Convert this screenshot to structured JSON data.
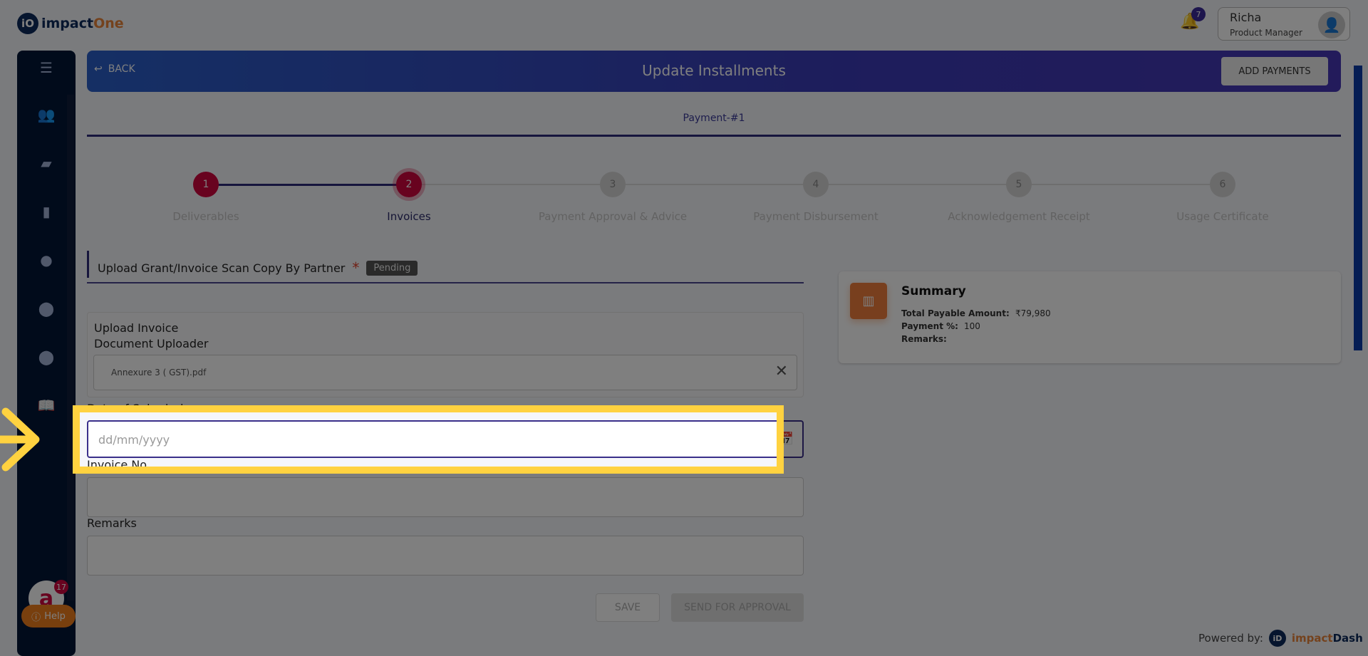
{
  "brand": {
    "logo_mark": "iO",
    "name_a": "impact",
    "name_b": "One"
  },
  "header": {
    "notifications": "7",
    "user_name": "Richa",
    "user_role": "Product Manager"
  },
  "banner": {
    "back": "BACK",
    "title": "Update Installments",
    "add_payments": "ADD PAYMENTS"
  },
  "tab": "Payment-#1",
  "steps": [
    {
      "num": "1",
      "label": "Deliverables",
      "state": "done"
    },
    {
      "num": "2",
      "label": "Invoices",
      "state": "current"
    },
    {
      "num": "3",
      "label": "Payment Approval & Advice",
      "state": "todo"
    },
    {
      "num": "4",
      "label": "Payment Disbursement",
      "state": "todo"
    },
    {
      "num": "5",
      "label": "Acknowledgement Receipt",
      "state": "todo"
    },
    {
      "num": "6",
      "label": "Usage Certificate",
      "state": "todo"
    }
  ],
  "section": {
    "title": "Upload Grant/Invoice Scan Copy By Partner",
    "required": "*",
    "status": "Pending"
  },
  "upload": {
    "title": "Upload Invoice",
    "subtitle": "Document Uploader",
    "file": "Annexure 3 ( GST).pdf"
  },
  "form": {
    "date_label": "Date of Submission",
    "date_placeholder": "dd/mm/yyyy",
    "invoice_label": "Invoice No",
    "remarks_label": "Remarks"
  },
  "buttons": {
    "save": "SAVE",
    "send": "SEND FOR APPROVAL"
  },
  "summary": {
    "title": "Summary",
    "total_label": "Total Payable Amount:",
    "total_value": "₹79,980",
    "pct_label": "Payment %:",
    "pct_value": "100",
    "remarks_label": "Remarks:"
  },
  "help": {
    "label": "Help",
    "bot_badge": "17"
  },
  "footer": {
    "powered": "Powered by:",
    "mark": "iD",
    "name_a": "impact",
    "name_b": "Dash"
  },
  "colors": {
    "accent": "#d0063f",
    "primary": "#2d2a7a",
    "highlight": "#ffd240"
  }
}
